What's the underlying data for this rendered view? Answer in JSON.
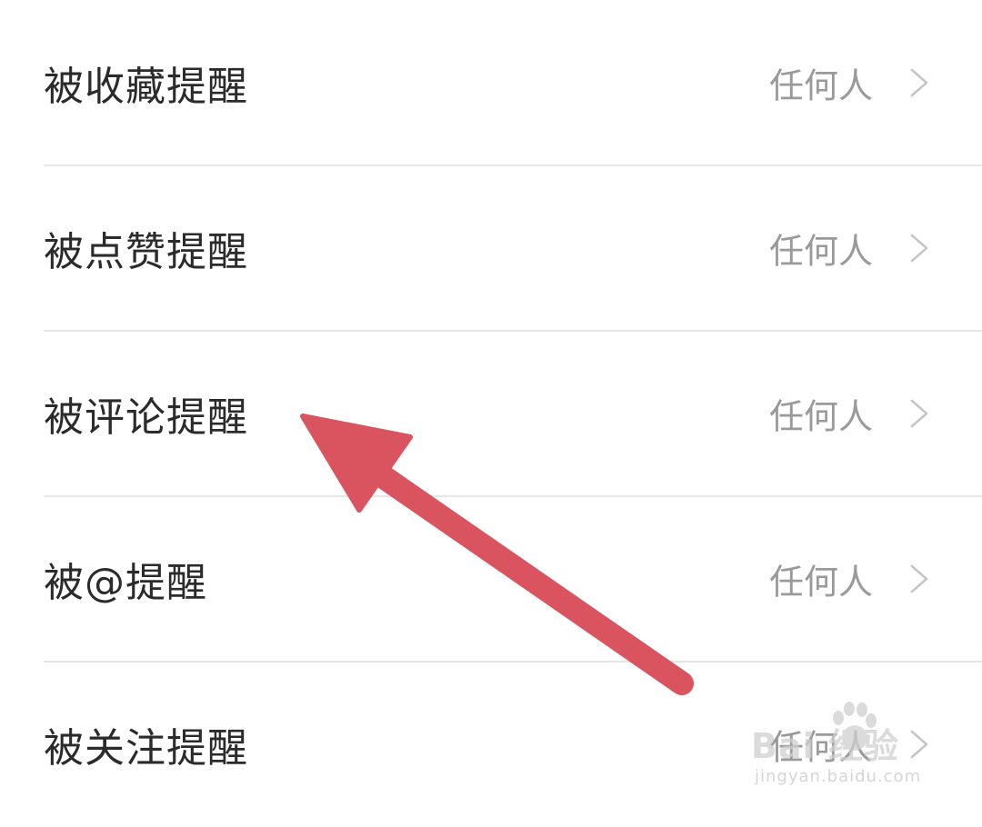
{
  "settings": {
    "items": [
      {
        "label": "被收藏提醒",
        "value": "任何人"
      },
      {
        "label": "被点赞提醒",
        "value": "任何人"
      },
      {
        "label": "被评论提醒",
        "value": "任何人"
      },
      {
        "label": "被@提醒",
        "value": "任何人"
      },
      {
        "label": "被关注提醒",
        "value": "任何人"
      }
    ]
  },
  "watermark": {
    "brand": "Bai 经验",
    "url": "jingyan.baidu.com"
  },
  "colors": {
    "arrow": "#d9545e",
    "label_text": "#2b2b2b",
    "value_text": "#9a9a9a",
    "divider": "#e6e6e6"
  }
}
